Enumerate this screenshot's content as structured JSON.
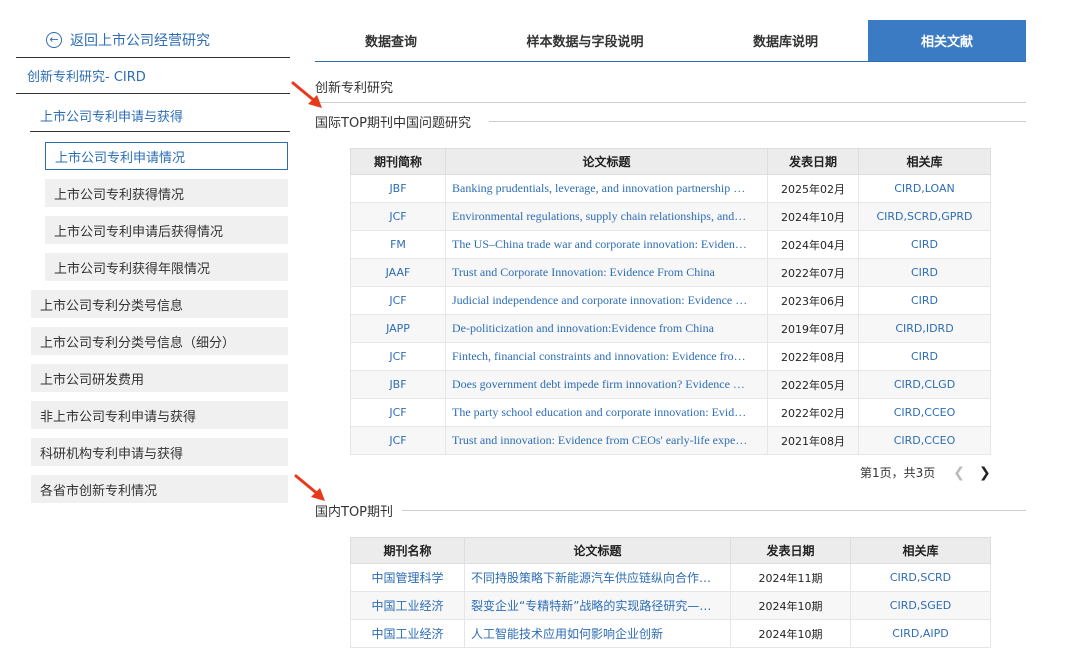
{
  "sidebar": {
    "back": "返回上市公司经营研究",
    "root": "创新专利研究- CIRD",
    "sub": "上市公司专利申请与获得",
    "leaves": [
      "上市公司专利申请情况",
      "上市公司专利获得情况",
      "上市公司专利申请后获得情况",
      "上市公司专利获得年限情况"
    ],
    "items": [
      "上市公司专利分类号信息",
      "上市公司专利分类号信息（细分）",
      "上市公司研发费用",
      "非上市公司专利申请与获得",
      "科研机构专利申请与获得",
      "各省市创新专利情况"
    ]
  },
  "tabs": [
    "数据查询",
    "样本数据与字段说明",
    "数据库说明",
    "相关文献"
  ],
  "breadcrumb": "创新专利研究",
  "intl": {
    "heading": "国际TOP期刊中国问题研究",
    "headers": [
      "期刊简称",
      "论文标题",
      "发表日期",
      "相关库"
    ],
    "rows": [
      [
        "JBF",
        "Banking prudentials, leverage, and innovation partnership …",
        "2025年02月",
        "CIRD,LOAN"
      ],
      [
        "JCF",
        "Environmental regulations, supply chain relationships, and…",
        "2024年10月",
        "CIRD,SCRD,GPRD"
      ],
      [
        "FM",
        "The US–China trade war and corporate innovation: Eviden…",
        "2024年04月",
        "CIRD"
      ],
      [
        "JAAF",
        "Trust and Corporate Innovation: Evidence From China",
        "2022年07月",
        "CIRD"
      ],
      [
        "JCF",
        "Judicial independence and corporate innovation: Evidence …",
        "2023年06月",
        "CIRD"
      ],
      [
        "JAPP",
        "De-politicization and innovation:Evidence from China",
        "2019年07月",
        "CIRD,IDRD"
      ],
      [
        "JCF",
        "Fintech, financial constraints and innovation: Evidence fro…",
        "2022年08月",
        "CIRD"
      ],
      [
        "JBF",
        "Does government debt impede firm innovation? Evidence …",
        "2022年05月",
        "CIRD,CLGD"
      ],
      [
        "JCF",
        "The party school education and corporate innovation: Evid…",
        "2022年02月",
        "CIRD,CCEO"
      ],
      [
        "JCF",
        "Trust and innovation: Evidence from CEOs' early-life expe…",
        "2021年08月",
        "CIRD,CCEO"
      ]
    ],
    "pager": "第1页，共3页"
  },
  "domestic": {
    "heading": "国内TOP期刊",
    "headers": [
      "期刊名称",
      "论文标题",
      "发表日期",
      "相关库"
    ],
    "rows": [
      [
        "中国管理科学",
        "不同持股策略下新能源汽车供应链纵向合作…",
        "2024年11期",
        "CIRD,SCRD"
      ],
      [
        "中国工业经济",
        "裂变企业“专精特新”战略的实现路径研究—…",
        "2024年10期",
        "CIRD,SGED"
      ],
      [
        "中国工业经济",
        "人工智能技术应用如何影响企业创新",
        "2024年10期",
        "CIRD,AIPD"
      ]
    ]
  },
  "colors": {
    "accent": "#2d6db5",
    "active_tab": "#3b7bc4",
    "arrow": "#e8391d"
  }
}
